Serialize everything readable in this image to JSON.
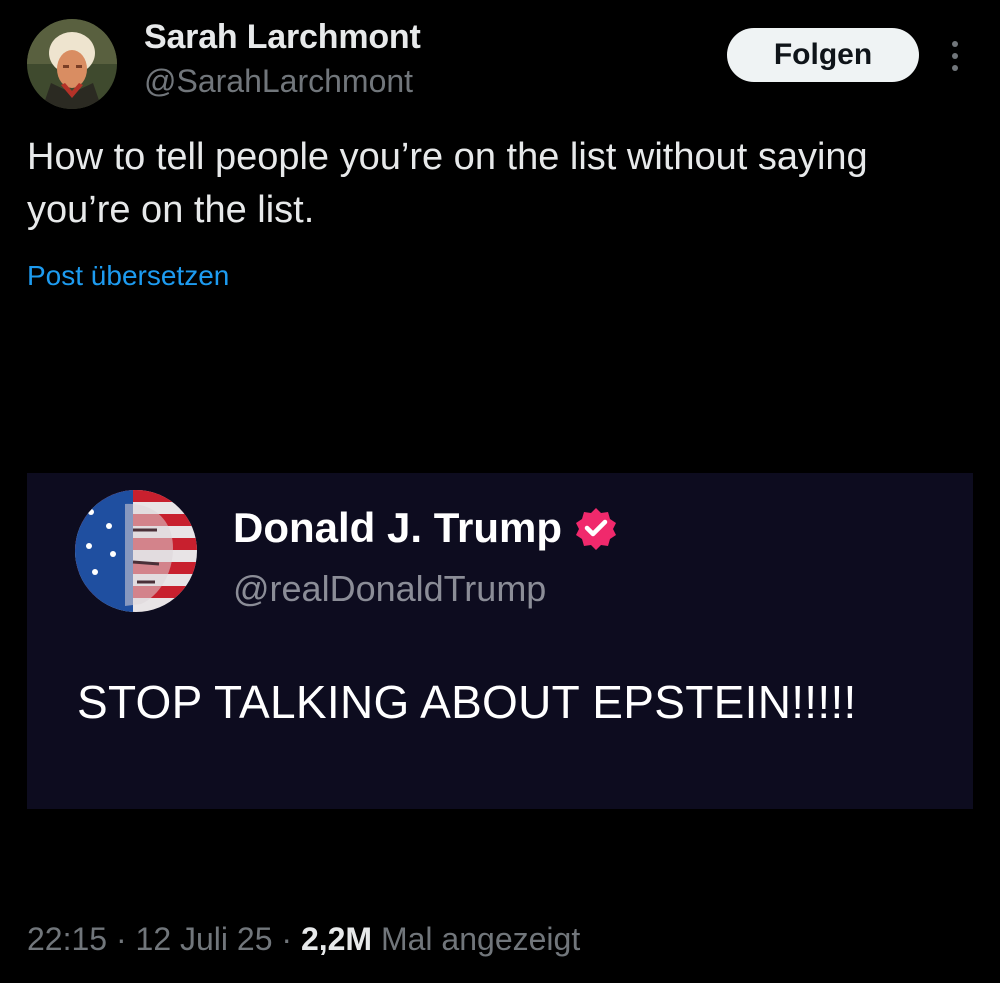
{
  "author": {
    "display_name": "Sarah Larchmont",
    "handle": "@SarahLarchmont"
  },
  "actions": {
    "follow_label": "Folgen",
    "more_icon": "more-vertical-icon"
  },
  "post": {
    "text": "How to tell people you’re on the list without saying you’re on the list.",
    "translate_label": "Post übersetzen"
  },
  "embedded_post": {
    "display_name": "Donald J. Trump",
    "handle": "@realDonaldTrump",
    "verified_icon": "verified-badge-icon",
    "text": "STOP TALKING ABOUT EPSTEIN!!!!!"
  },
  "meta": {
    "time": "22:15",
    "separator": "·",
    "date": "12 Juli 25",
    "views_count": "2,2M",
    "views_label": "Mal angezeigt"
  },
  "colors": {
    "background": "#000000",
    "link": "#1d9bf0",
    "secondary_text": "#71767b",
    "follow_button_bg": "#eff3f4",
    "embed_card_bg": "#0d0c1f",
    "verified_badge": "#f0296c"
  }
}
